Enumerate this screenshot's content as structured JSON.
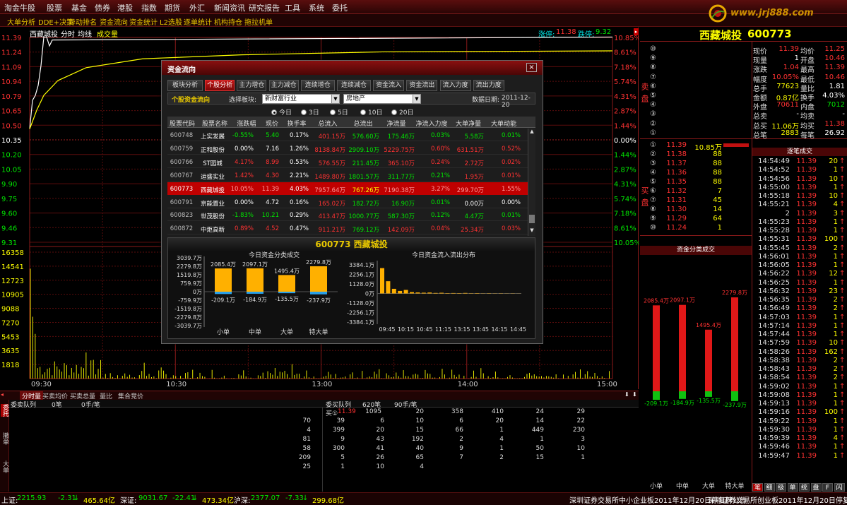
{
  "menu": [
    "淘金牛股",
    "股票",
    "基金",
    "债券",
    "港股",
    "指数",
    "期货",
    "外汇",
    "新闻资讯",
    "研究报告",
    "工具",
    "系统",
    "委托"
  ],
  "toolbar": [
    "大单分析",
    "DDE+决策",
    "异动排名",
    "资金流向",
    "资金统计",
    "L2选股",
    "逐单统计",
    "机构持仓",
    "拖拉机单"
  ],
  "logo": {
    "text": "www.jrj888.com"
  },
  "chart": {
    "stock_name": "西藏城投",
    "tabs": [
      "分时",
      "均线",
      "成交量"
    ],
    "limit_up_label": "涨停:",
    "limit_up": "11.38",
    "limit_down_label": "跌停:",
    "limit_down": "9.32",
    "level_label": "L1",
    "price_ticks": [
      "11.39",
      "11.24",
      "11.09",
      "10.94",
      "10.79",
      "10.65",
      "10.50",
      "10.35",
      "10.20",
      "10.05",
      "9.90",
      "9.75",
      "9.60",
      "9.46",
      "9.31"
    ],
    "pct_ticks": [
      "10.85%",
      "8.61%",
      "7.18%",
      "5.74%",
      "4.31%",
      "2.87%",
      "1.44%",
      "0.00%",
      "1.44%",
      "2.87%",
      "4.31%",
      "5.74%",
      "7.18%",
      "8.61%",
      "10.05%"
    ],
    "vol_ticks": [
      "16358",
      "14541",
      "12723",
      "10905",
      "9088",
      "7270",
      "5453",
      "3635",
      "1818"
    ],
    "time_ticks": [
      "09:30",
      "10:30",
      "13:00",
      "14:00",
      "15:00"
    ]
  },
  "bottom_tabs": [
    "分时量",
    "买卖均价",
    "买卖总量",
    "量比",
    "集合竞价"
  ],
  "queue": {
    "side_labels": [
      "委托",
      "撤单",
      "大单"
    ],
    "sell_title": "委卖队列",
    "sell_count": "0笔",
    "sell_avg": "0手/笔",
    "buy_title": "委买队列",
    "buy_count": "620笔",
    "buy_avg": "90手/笔",
    "buy_first_label": "买①",
    "buy_first_price": "11.39",
    "rows": [
      [
        "",
        "1095",
        "20",
        "358",
        "410",
        "24",
        "29"
      ],
      [
        "70",
        "39",
        "6",
        "10",
        "6",
        "20",
        "14",
        "22"
      ],
      [
        "4",
        "399",
        "20",
        "15",
        "66",
        "1",
        "449",
        "230"
      ],
      [
        "81",
        "9",
        "43",
        "192",
        "2",
        "4",
        "1",
        "3"
      ],
      [
        "58",
        "300",
        "41",
        "40",
        "9",
        "1",
        "50",
        "10"
      ],
      [
        "209",
        "5",
        "26",
        "65",
        "7",
        "2",
        "15",
        "1"
      ],
      [
        "25",
        "1",
        "10",
        "4"
      ]
    ]
  },
  "status_bar": [
    {
      "t": "上证:",
      "c": "white"
    },
    {
      "t": "2215.93",
      "c": "green"
    },
    {
      "t": "-2.31",
      "c": "green"
    },
    {
      "t": "↓",
      "c": "green"
    },
    {
      "t": "465.64亿",
      "c": "yellow"
    },
    {
      "t": "深证:",
      "c": "white"
    },
    {
      "t": "9031.67",
      "c": "green"
    },
    {
      "t": "-22.41",
      "c": "green"
    },
    {
      "t": "↓",
      "c": "green"
    },
    {
      "t": "473.34亿",
      "c": "yellow"
    },
    {
      "t": "沪深:",
      "c": "white"
    },
    {
      "t": "2377.07",
      "c": "green"
    },
    {
      "t": "-7.33",
      "c": "green"
    },
    {
      "t": "↓",
      "c": "green"
    },
    {
      "t": "299.68亿",
      "c": "yellow"
    },
    {
      "t": "深圳证券交易所中小企业板2011年12月20日停复牌公告",
      "c": "white"
    },
    {
      "t": "深圳证券交易所创业板2011年12月20日停复",
      "c": "white"
    }
  ],
  "right": {
    "name": "西藏城投",
    "code": "600773",
    "side_sell": "卖盘",
    "side_buy": "买盘",
    "quote": [
      [
        "现价",
        "11.39",
        "red",
        "均价",
        "11.25",
        "red"
      ],
      [
        "现量",
        "1",
        "white",
        "开盘",
        "10.46",
        "red"
      ],
      [
        "涨跌",
        "1.04",
        "red",
        "最高",
        "11.39",
        "red"
      ],
      [
        "幅度",
        "10.05%",
        "red",
        "最低",
        "10.46",
        "red"
      ],
      [
        "总手",
        "77623",
        "yellow",
        "量比",
        "1.81",
        "white"
      ],
      [
        "金额",
        "0.87亿",
        "yellow",
        "换手",
        "4.03%",
        "white"
      ],
      [
        "外盘",
        "70611",
        "red",
        "内盘",
        "7012",
        "green"
      ],
      [
        "总卖",
        "-",
        "white",
        "均卖",
        "-",
        "white"
      ],
      [
        "总买",
        "11.06万",
        "yellow",
        "均买",
        "11.38",
        "red"
      ],
      [
        "总笔",
        "2883",
        "yellow",
        "每笔",
        "26.92",
        "white"
      ]
    ],
    "sell_levels": [
      "⑩",
      "⑨",
      "⑧",
      "⑦",
      "⑥",
      "⑤",
      "④",
      "③",
      "②",
      "①"
    ],
    "buy_book": [
      [
        "①",
        "11.39",
        "10.85万"
      ],
      [
        "②",
        "11.38",
        "88"
      ],
      [
        "③",
        "11.37",
        "88"
      ],
      [
        "④",
        "11.36",
        "88"
      ],
      [
        "⑤",
        "11.35",
        "88"
      ],
      [
        "⑥",
        "11.32",
        "7"
      ],
      [
        "⑦",
        "11.31",
        "45"
      ],
      [
        "⑧",
        "11.30",
        "14"
      ],
      [
        "⑨",
        "11.29",
        "64"
      ],
      [
        "⑩",
        "11.24",
        "1"
      ]
    ],
    "trades_title": "逐笔成交",
    "trades": [
      [
        "14:54:49",
        "11.39",
        "20",
        "↑"
      ],
      [
        "14:54:52",
        "11.39",
        "1",
        "↑"
      ],
      [
        "14:54:56",
        "11.39",
        "10",
        "↑"
      ],
      [
        "14:55:00",
        "11.39",
        "1",
        "↑"
      ],
      [
        "14:55:18",
        "11.39",
        "10",
        "↑"
      ],
      [
        "14:55:21",
        "11.39",
        "4",
        "↑"
      ],
      [
        "2",
        "11.39",
        "3",
        "↑"
      ],
      [
        "14:55:23",
        "11.39",
        "1",
        "↑"
      ],
      [
        "14:55:28",
        "11.39",
        "1",
        "↑"
      ],
      [
        "14:55:31",
        "11.39",
        "100",
        "↑"
      ],
      [
        "14:55:45",
        "11.39",
        "2",
        "↑"
      ],
      [
        "14:56:01",
        "11.39",
        "1",
        "↑"
      ],
      [
        "14:56:05",
        "11.39",
        "1",
        "↑"
      ],
      [
        "14:56:22",
        "11.39",
        "12",
        "↑"
      ],
      [
        "14:56:25",
        "11.39",
        "1",
        "↑"
      ],
      [
        "14:56:32",
        "11.39",
        "23",
        "↑"
      ],
      [
        "14:56:35",
        "11.39",
        "2",
        "↑"
      ],
      [
        "14:56:49",
        "11.39",
        "2",
        "↑"
      ],
      [
        "14:57:03",
        "11.39",
        "1",
        "↑"
      ],
      [
        "14:57:14",
        "11.39",
        "1",
        "↑"
      ],
      [
        "14:57:44",
        "11.39",
        "1",
        "↑"
      ],
      [
        "14:57:59",
        "11.39",
        "10",
        "↑"
      ],
      [
        "14:58:26",
        "11.39",
        "162",
        "↑"
      ],
      [
        "14:58:38",
        "11.39",
        "2",
        "↑"
      ],
      [
        "14:58:43",
        "11.39",
        "2",
        "↑"
      ],
      [
        "14:58:54",
        "11.39",
        "2",
        "↑"
      ],
      [
        "14:59:02",
        "11.39",
        "1",
        "↑"
      ],
      [
        "14:59:08",
        "11.39",
        "1",
        "↑"
      ],
      [
        "14:59:13",
        "11.39",
        "1",
        "↑"
      ],
      [
        "14:59:16",
        "11.39",
        "100",
        "↑"
      ],
      [
        "14:59:22",
        "11.39",
        "1",
        "↑"
      ],
      [
        "14:59:30",
        "11.39",
        "1",
        "↑"
      ],
      [
        "14:59:39",
        "11.39",
        "4",
        "↑"
      ],
      [
        "14:59:46",
        "11.39",
        "1",
        "↑"
      ],
      [
        "14:59:47",
        "11.39",
        "1",
        "↑"
      ]
    ],
    "trade_tabs": [
      "笔",
      "细",
      "级",
      "单",
      "统",
      "盘",
      "F",
      "闪"
    ],
    "fund_title": "资金分类成交",
    "fund_bars": [
      {
        "label": "小单",
        "in": "2085.4万",
        "out": "-209.1万",
        "inv": 2085.4,
        "outv": 209.1
      },
      {
        "label": "中单",
        "in": "2097.1万",
        "out": "-184.9万",
        "inv": 2097.1,
        "outv": 184.9
      },
      {
        "label": "大单",
        "in": "1495.4万",
        "out": "-135.5万",
        "inv": 1495.4,
        "outv": 135.5
      },
      {
        "label": "特大单",
        "in": "2279.8万",
        "out": "-237.9万",
        "inv": 2279.8,
        "outv": 237.9
      }
    ]
  },
  "dialog": {
    "title": "资金流向",
    "close": "×",
    "tabs": [
      "板块分析",
      "个股分析",
      "主力增仓",
      "主力减仓",
      "连续增仓",
      "连续减仓",
      "资金流入",
      "资金流出",
      "流入力度",
      "流出力度"
    ],
    "active_tab": 1,
    "subtitle": "个股资金流向",
    "sector_label": "选择板块:",
    "sector_value": "新财富行业",
    "sub_value": "房地产",
    "date_label": "数据日期:",
    "date": "2011-12-20",
    "periods": [
      "今日",
      "3日",
      "5日",
      "10日",
      "20日"
    ],
    "columns": [
      "股票代码",
      "股票名称",
      "涨跌幅",
      "现价",
      "换手率",
      "总流入",
      "总流出",
      "净流量",
      "净流入力度",
      "大单净量",
      "大单动能"
    ],
    "rows": [
      [
        "600748",
        "上实发展",
        "-0.55%",
        "5.40",
        "0.17%",
        "401.15万",
        "576.60万",
        "175.46万",
        "0.03%",
        "5.58万",
        "0.01%"
      ],
      [
        "600759",
        "正和股份",
        "0.00%",
        "7.16",
        "1.26%",
        "8138.84万",
        "2909.10万",
        "5229.75万",
        "0.60%",
        "631.51万",
        "0.52%"
      ],
      [
        "600766",
        "ST园城",
        "4.17%",
        "8.99",
        "0.53%",
        "576.55万",
        "211.45万",
        "365.10万",
        "0.24%",
        "2.72万",
        "0.02%"
      ],
      [
        "600767",
        "运盛实业",
        "1.42%",
        "4.30",
        "2.21%",
        "1489.80万",
        "1801.57万",
        "311.77万",
        "0.21%",
        "1.95万",
        "0.01%"
      ],
      [
        "600773",
        "西藏城投",
        "10.05%",
        "11.39",
        "4.03%",
        "7957.64万",
        "767.26万",
        "7190.38万",
        "3.27%",
        "299.70万",
        "1.55%"
      ],
      [
        "600791",
        "京能置业",
        "0.00%",
        "4.72",
        "0.16%",
        "165.02万",
        "182.72万",
        "16.90万",
        "0.01%",
        "0.00万",
        "0.00%"
      ],
      [
        "600823",
        "世茂股份",
        "-1.83%",
        "10.21",
        "0.29%",
        "413.47万",
        "1000.77万",
        "587.30万",
        "0.12%",
        "4.47万",
        "0.01%"
      ],
      [
        "600872",
        "中炬高新",
        "0.89%",
        "4.52",
        "0.47%",
        "911.21万",
        "769.12万",
        "142.09万",
        "0.04%",
        "25.34万",
        "0.03%"
      ]
    ],
    "selected_row": 4,
    "row_colors": [
      [
        "gray",
        "white",
        "green",
        "green",
        "white",
        "red",
        "green",
        "green",
        "green",
        "green",
        "green"
      ],
      [
        "gray",
        "white",
        "white",
        "white",
        "white",
        "red",
        "green",
        "red",
        "red",
        "red",
        "red"
      ],
      [
        "gray",
        "white",
        "red",
        "red",
        "white",
        "red",
        "green",
        "red",
        "red",
        "red",
        "red"
      ],
      [
        "gray",
        "white",
        "red",
        "red",
        "white",
        "red",
        "green",
        "green",
        "green",
        "red",
        "red"
      ],
      [
        "white",
        "white",
        "red",
        "red",
        "white",
        "red",
        "yellow",
        "red",
        "red",
        "red",
        "red"
      ],
      [
        "gray",
        "white",
        "white",
        "white",
        "white",
        "red",
        "green",
        "green",
        "green",
        "white",
        "white"
      ],
      [
        "gray",
        "white",
        "green",
        "green",
        "white",
        "red",
        "green",
        "green",
        "green",
        "green",
        "green"
      ],
      [
        "gray",
        "white",
        "red",
        "red",
        "white",
        "red",
        "green",
        "red",
        "red",
        "red",
        "red"
      ]
    ],
    "panel_title": "600773 西藏城投",
    "left_chart": {
      "title": "今日资金分类成交",
      "yticks": [
        "3039.7万",
        "2279.8万",
        "1519.8万",
        "759.9万",
        "0万",
        "-759.9万",
        "-1519.8万",
        "-2279.8万",
        "-3039.7万"
      ],
      "categories": [
        "小单",
        "中单",
        "大单",
        "特大单"
      ],
      "in_labels": [
        "2085.4万",
        "2097.1万",
        "1495.4万",
        "2279.8万"
      ],
      "out_labels": [
        "-209.1万",
        "-184.9万",
        "-135.5万",
        "-237.9万"
      ],
      "in_values": [
        2085.4,
        2097.1,
        1495.4,
        2279.8
      ],
      "out_values": [
        209.1,
        184.9,
        135.5,
        237.9
      ],
      "ymax": 3039.7
    },
    "right_chart": {
      "title": "今日资金流入流出分布",
      "yticks": [
        "3384.1万",
        "2256.1万",
        "1128.0万",
        "0万",
        "-1128.0万",
        "-2256.1万",
        "-3384.1万"
      ],
      "xticks": [
        "09:45",
        "10:15",
        "10:45",
        "11:15",
        "13:15",
        "13:45",
        "14:15",
        "14:45"
      ],
      "ymax": 3384.1,
      "values": [
        3000,
        1450,
        550,
        300,
        420,
        160,
        120,
        90,
        110,
        60,
        80,
        40,
        50,
        40,
        60,
        30,
        40,
        20,
        30,
        20,
        25,
        15,
        20,
        10
      ]
    }
  }
}
